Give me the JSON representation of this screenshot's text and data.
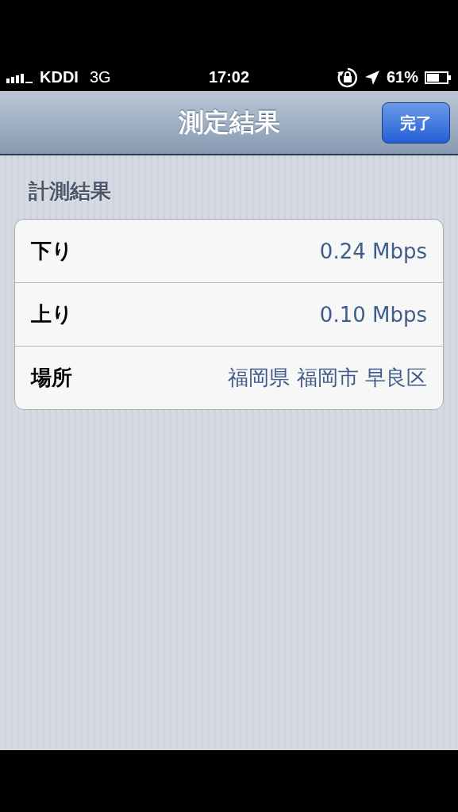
{
  "status_bar": {
    "carrier": "KDDI",
    "network": "3G",
    "time": "17:02",
    "battery": "61%"
  },
  "nav_bar": {
    "title": "測定結果",
    "done_button": "完了"
  },
  "section": {
    "header": "計測結果",
    "rows": [
      {
        "label": "下り",
        "value": "0.24 Mbps"
      },
      {
        "label": "上り",
        "value": "0.10 Mbps"
      },
      {
        "label": "場所",
        "value": "福岡県 福岡市 早良区"
      }
    ]
  }
}
